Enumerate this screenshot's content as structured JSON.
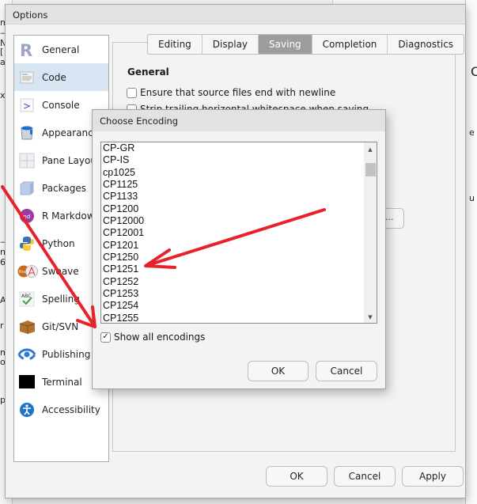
{
  "options_dialog": {
    "title": "Options",
    "sidebar": [
      {
        "label": "General",
        "icon": "r-logo-icon"
      },
      {
        "label": "Code",
        "icon": "code-document-icon",
        "selected": true
      },
      {
        "label": "Console",
        "icon": "console-prompt-icon"
      },
      {
        "label": "Appearance",
        "icon": "paint-bucket-icon"
      },
      {
        "label": "Pane Layout",
        "icon": "pane-layout-icon"
      },
      {
        "label": "Packages",
        "icon": "package-box-icon"
      },
      {
        "label": "R Markdown",
        "icon": "rmarkdown-icon"
      },
      {
        "label": "Python",
        "icon": "python-icon"
      },
      {
        "label": "Sweave",
        "icon": "sweave-icon"
      },
      {
        "label": "Spelling",
        "icon": "spelling-check-icon"
      },
      {
        "label": "Git/SVN",
        "icon": "git-box-icon"
      },
      {
        "label": "Publishing",
        "icon": "publishing-icon"
      },
      {
        "label": "Terminal",
        "icon": "terminal-icon"
      },
      {
        "label": "Accessibility",
        "icon": "accessibility-icon"
      }
    ],
    "tabs": [
      {
        "label": "Editing"
      },
      {
        "label": "Display"
      },
      {
        "label": "Saving",
        "active": true
      },
      {
        "label": "Completion"
      },
      {
        "label": "Diagnostics"
      }
    ],
    "section_title": "General",
    "checkboxes": [
      {
        "label": "Ensure that source files end with newline",
        "checked": false
      },
      {
        "label": "Strip trailing horizontal whitespace when saving",
        "checked": false
      }
    ],
    "partial_button_label": "...",
    "buttons": {
      "ok": "OK",
      "cancel": "Cancel",
      "apply": "Apply"
    }
  },
  "encoding_dialog": {
    "title": "Choose Encoding",
    "encodings": [
      "CP-GR",
      "CP-IS",
      "cp1025",
      "CP1125",
      "CP1133",
      "CP1200",
      "CP12000",
      "CP12001",
      "CP1201",
      "CP1250",
      "CP1251",
      "CP1252",
      "CP1253",
      "CP1254",
      "CP1255"
    ],
    "show_all_label": "Show all encodings",
    "show_all_checked": true,
    "buttons": {
      "ok": "OK",
      "cancel": "Cancel"
    }
  },
  "annotation_color": "#e8222a",
  "background_fragments": [
    "m",
    "—",
    "N",
    "[",
    "a",
    "x",
    "—",
    "n",
    "6",
    "A",
    "r",
    "m",
    "o",
    "p",
    "C",
    "e",
    "u"
  ]
}
